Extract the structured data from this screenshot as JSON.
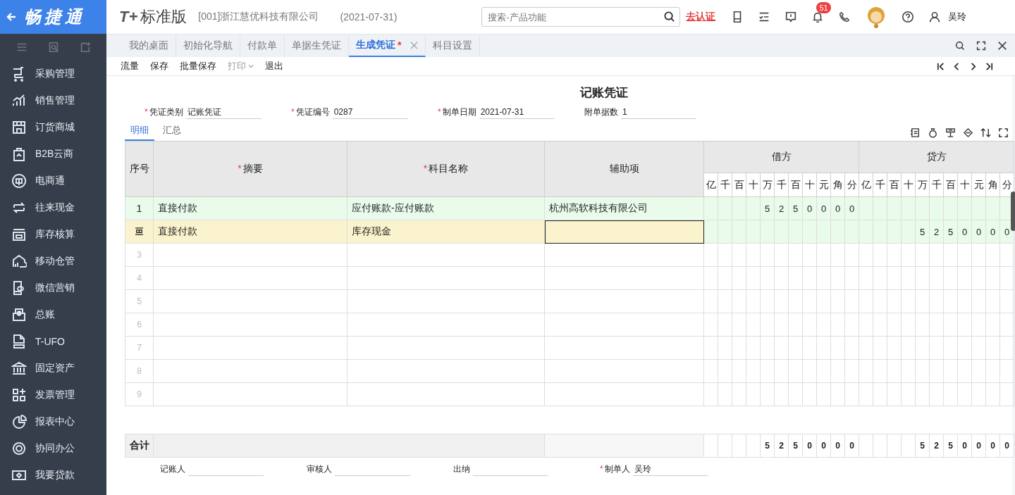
{
  "brand": {
    "name": "畅捷通"
  },
  "header": {
    "logo_mark": "T+",
    "edition": "标准版",
    "company": "[001]浙江慧优科技有限公司",
    "date": "(2021-07-31)",
    "search": {
      "placeholder": "搜索-产品功能"
    },
    "verify_link": "去认证",
    "notification_count": "51",
    "user": "吴玲"
  },
  "sidebar": {
    "items": [
      {
        "label": "采购管理"
      },
      {
        "label": "销售管理"
      },
      {
        "label": "订货商城"
      },
      {
        "label": "B2B云商"
      },
      {
        "label": "电商通"
      },
      {
        "label": "往来现金"
      },
      {
        "label": "库存核算"
      },
      {
        "label": "移动仓管"
      },
      {
        "label": "微信营销"
      },
      {
        "label": "总账"
      },
      {
        "label": "T-UFO"
      },
      {
        "label": "固定资产"
      },
      {
        "label": "发票管理"
      },
      {
        "label": "报表中心"
      },
      {
        "label": "协同办公"
      },
      {
        "label": "我要贷款"
      }
    ]
  },
  "required_mark": "*",
  "tabs": [
    {
      "label": "我的桌面",
      "selected": false,
      "closable": false,
      "modified": false
    },
    {
      "label": "初始化导航",
      "selected": false,
      "closable": false,
      "modified": false
    },
    {
      "label": "付款单",
      "selected": false,
      "closable": false,
      "modified": false
    },
    {
      "label": "单据生凭证",
      "selected": false,
      "closable": false,
      "modified": false
    },
    {
      "label": "生成凭证",
      "selected": true,
      "closable": true,
      "modified": true
    },
    {
      "label": "科目设置",
      "selected": false,
      "closable": false,
      "modified": false
    }
  ],
  "toolbar": [
    {
      "label": "流量",
      "disabled": false,
      "dropdown": false
    },
    {
      "label": "保存",
      "disabled": false,
      "dropdown": false
    },
    {
      "label": "批量保存",
      "disabled": false,
      "dropdown": false
    },
    {
      "label": "打印",
      "disabled": true,
      "dropdown": true
    },
    {
      "label": "退出",
      "disabled": false,
      "dropdown": false
    }
  ],
  "voucher": {
    "title": "记账凭证",
    "fields": [
      {
        "label": "凭证类别",
        "value": "记账凭证",
        "required": true
      },
      {
        "label": "凭证编号",
        "value": "0287",
        "required": true
      },
      {
        "label": "制单日期",
        "value": "2021-07-31",
        "required": true
      },
      {
        "label": "附单据数",
        "value": "1",
        "required": false
      }
    ],
    "subtabs": [
      {
        "label": "明细",
        "selected": true
      },
      {
        "label": "汇总",
        "selected": false
      }
    ],
    "table": {
      "columns": [
        {
          "label": "序号",
          "required": false
        },
        {
          "label": "摘要",
          "required": true
        },
        {
          "label": "科目名称",
          "required": true
        },
        {
          "label": "辅助项",
          "required": false
        }
      ],
      "debit_label": "借方",
      "credit_label": "贷方",
      "debit_units": [
        "亿",
        "千",
        "百",
        "十",
        "万",
        "千",
        "百",
        "十",
        "元",
        "角",
        "分"
      ],
      "credit_units": [
        "亿",
        "千",
        "百",
        "十",
        "万",
        "千",
        "百",
        "十",
        "元",
        "角",
        "分"
      ],
      "rows": [
        {
          "seq": "1",
          "kind": "filled",
          "selected": false,
          "summary": "直接付款",
          "account": "应付账款-应付账款",
          "auxiliary": "杭州高软科技有限公司",
          "debit": [
            "5",
            "2",
            "5",
            "0",
            "0",
            "0",
            "0"
          ]
        },
        {
          "kind": "filled",
          "selected": true,
          "summary": "直接付款",
          "account": "库存现金",
          "credit": [
            "5",
            "2",
            "5",
            "0",
            "0",
            "0",
            "0"
          ]
        },
        {
          "seq": "3",
          "kind": "empty",
          "selected": false
        },
        {
          "seq": "4",
          "kind": "empty",
          "selected": false
        },
        {
          "seq": "5",
          "kind": "empty",
          "selected": false
        },
        {
          "seq": "6",
          "kind": "empty",
          "selected": false
        },
        {
          "seq": "7",
          "kind": "empty",
          "selected": false
        },
        {
          "seq": "8",
          "kind": "empty",
          "selected": false
        },
        {
          "seq": "9",
          "kind": "empty",
          "selected": false
        }
      ],
      "total": {
        "label": "合计",
        "debit": [
          "5",
          "2",
          "5",
          "0",
          "0",
          "0",
          "0"
        ],
        "credit": [
          "5",
          "2",
          "5",
          "0",
          "0",
          "0",
          "0"
        ]
      }
    },
    "signatures": [
      {
        "label": "记账人",
        "required": false
      },
      {
        "label": "审核人",
        "required": false
      },
      {
        "label": "出纳",
        "required": false
      },
      {
        "label": "制单人",
        "value": "吴玲",
        "required": true
      }
    ]
  }
}
